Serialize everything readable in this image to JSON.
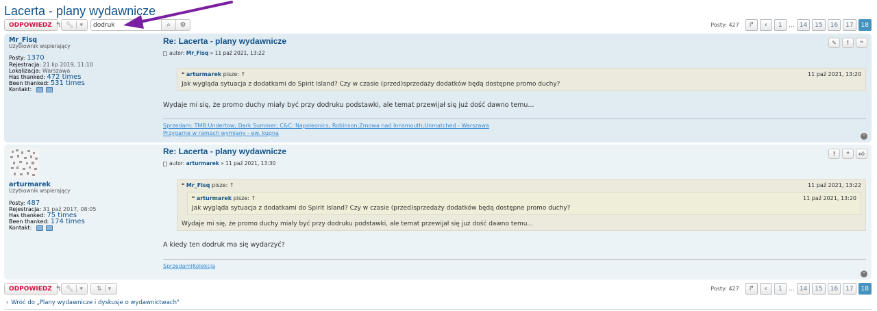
{
  "topic": {
    "title": "Lacerta - plany wydawnicze"
  },
  "toolbar": {
    "reply_label": "ODPOWIEDZ",
    "search_value": "dodruk",
    "posts_count": "Posty: 427"
  },
  "pagination": {
    "pages_first": "1",
    "ellipsis": "…",
    "pages_tail": [
      "14",
      "15",
      "16",
      "17"
    ],
    "current": "18"
  },
  "posts": [
    {
      "author": "Mr_Fisq",
      "rank": "Użytkownik wspierający",
      "posts_label": "Posty:",
      "posts_value": "1370",
      "reg_label": "Rejestracja:",
      "reg_value": "21 lip 2019, 11:10",
      "loc_label": "Lokalizacja:",
      "loc_value": "Warszawa",
      "has_thanked_label": "Has thanked:",
      "has_thanked_value": "472 times",
      "been_thanked_label": "Been thanked:",
      "been_thanked_value": "531 times",
      "contact_label": "Kontakt:",
      "title": "Re: Lacerta - plany wydawnicze",
      "author_prefix": "autor:",
      "date": "» 11 paź 2021, 13:22",
      "quote": {
        "author": "arturmarek",
        "says": "pisze: ↑",
        "date": "11 paź 2021, 13:20",
        "text": "Jak wygląda sytuacja z dodatkami do Spirit Island? Czy w czasie (przed)sprzedaży dodatków będą dostępne promo duchy?"
      },
      "content": "Wydaje mi się, że promo duchy miały być przy dodruku podstawki, ale temat przewijał się już dość dawno temu...",
      "signature": [
        "Sprzedam: TMB:Undertow; Dark Summer; C&C: Napoleonics; Robinson;Zmowa nad Innsmouth;Unmatched - Warszawa",
        "Przygarnę w ramach wymiany - ew. kupna"
      ]
    },
    {
      "author": "arturmarek",
      "rank": "Użytkownik wspierający",
      "posts_label": "Posty:",
      "posts_value": "487",
      "reg_label": "Rejestracja:",
      "reg_value": "31 paź 2017, 08:05",
      "has_thanked_label": "Has thanked:",
      "has_thanked_value": "75 times",
      "been_thanked_label": "Been thanked:",
      "been_thanked_value": "174 times",
      "contact_label": "Kontakt:",
      "title": "Re: Lacerta - plany wydawnicze",
      "author_prefix": "autor:",
      "date": "» 11 paź 2021, 13:30",
      "quote": {
        "author": "Mr_Fisq",
        "says": "pisze: ↑",
        "date": "11 paź 2021, 13:22",
        "inner": {
          "author": "arturmarek",
          "says": "pisze: ↑",
          "date": "11 paź 2021, 13:20",
          "text": "Jak wygląda sytuacja z dodatkami do Spirit Island? Czy w czasie (przed)sprzedaży dodatków będą dostępne promo duchy?"
        },
        "text": "Wydaje mi się, że promo duchy miały być przy dodruku podstawki, ale temat przewijał się już dość dawno temu..."
      },
      "content": "A kiedy ten dodruk ma się wydarzyć?",
      "signature": [
        "Sprzedam|Kolekcja"
      ]
    }
  ],
  "footer": {
    "back_link": "Wróć do „Plany wydawnicze i dyskusje o wydawnictwach\""
  },
  "colors": {
    "accent": "#105289",
    "reply": "#d31141",
    "current_page": "#4692bf",
    "arrow": "#7b1fa2"
  }
}
